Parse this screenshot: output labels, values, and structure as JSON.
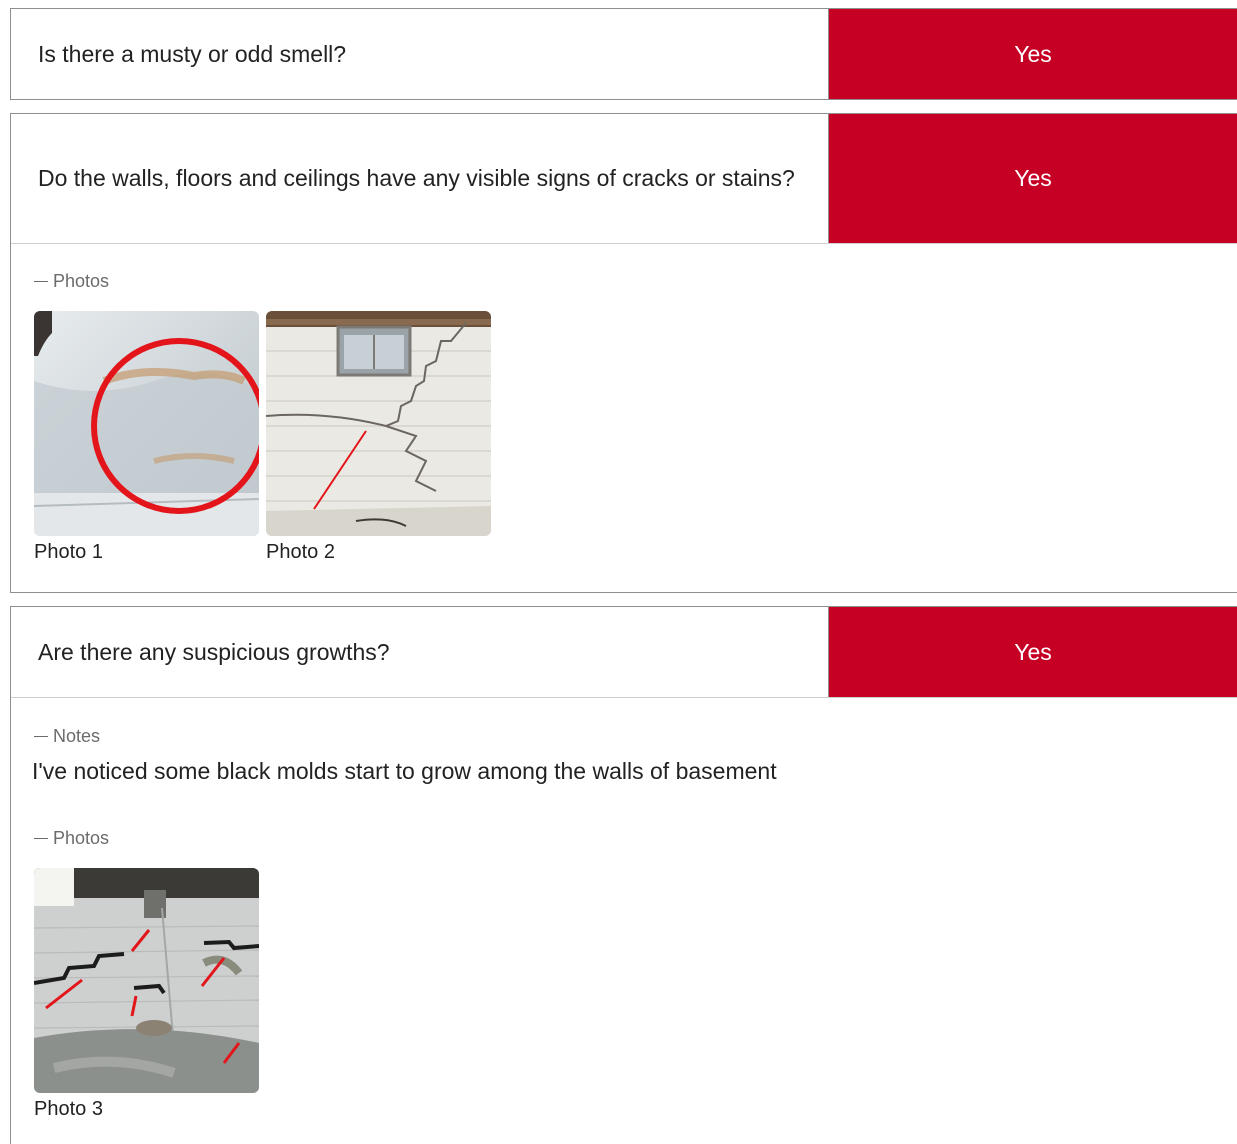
{
  "questions": [
    {
      "text": "Is there a musty or odd smell?",
      "answer": "Yes"
    },
    {
      "text": "Do the walls, floors and ceilings have any visible signs of cracks or stains?",
      "answer": "Yes",
      "photos_label": "Photos",
      "photos": [
        {
          "caption": "Photo 1"
        },
        {
          "caption": "Photo 2"
        }
      ]
    },
    {
      "text": "Are there any suspicious growths?",
      "answer": "Yes",
      "notes_label": "Notes",
      "notes": "I've noticed some black molds start to grow among the walls of basement",
      "photos_label": "Photos",
      "photos": [
        {
          "caption": "Photo 3"
        }
      ]
    }
  ],
  "colors": {
    "answer_background": "#c50024",
    "border": "#8f8f8f",
    "label": "#6b6b6b"
  }
}
